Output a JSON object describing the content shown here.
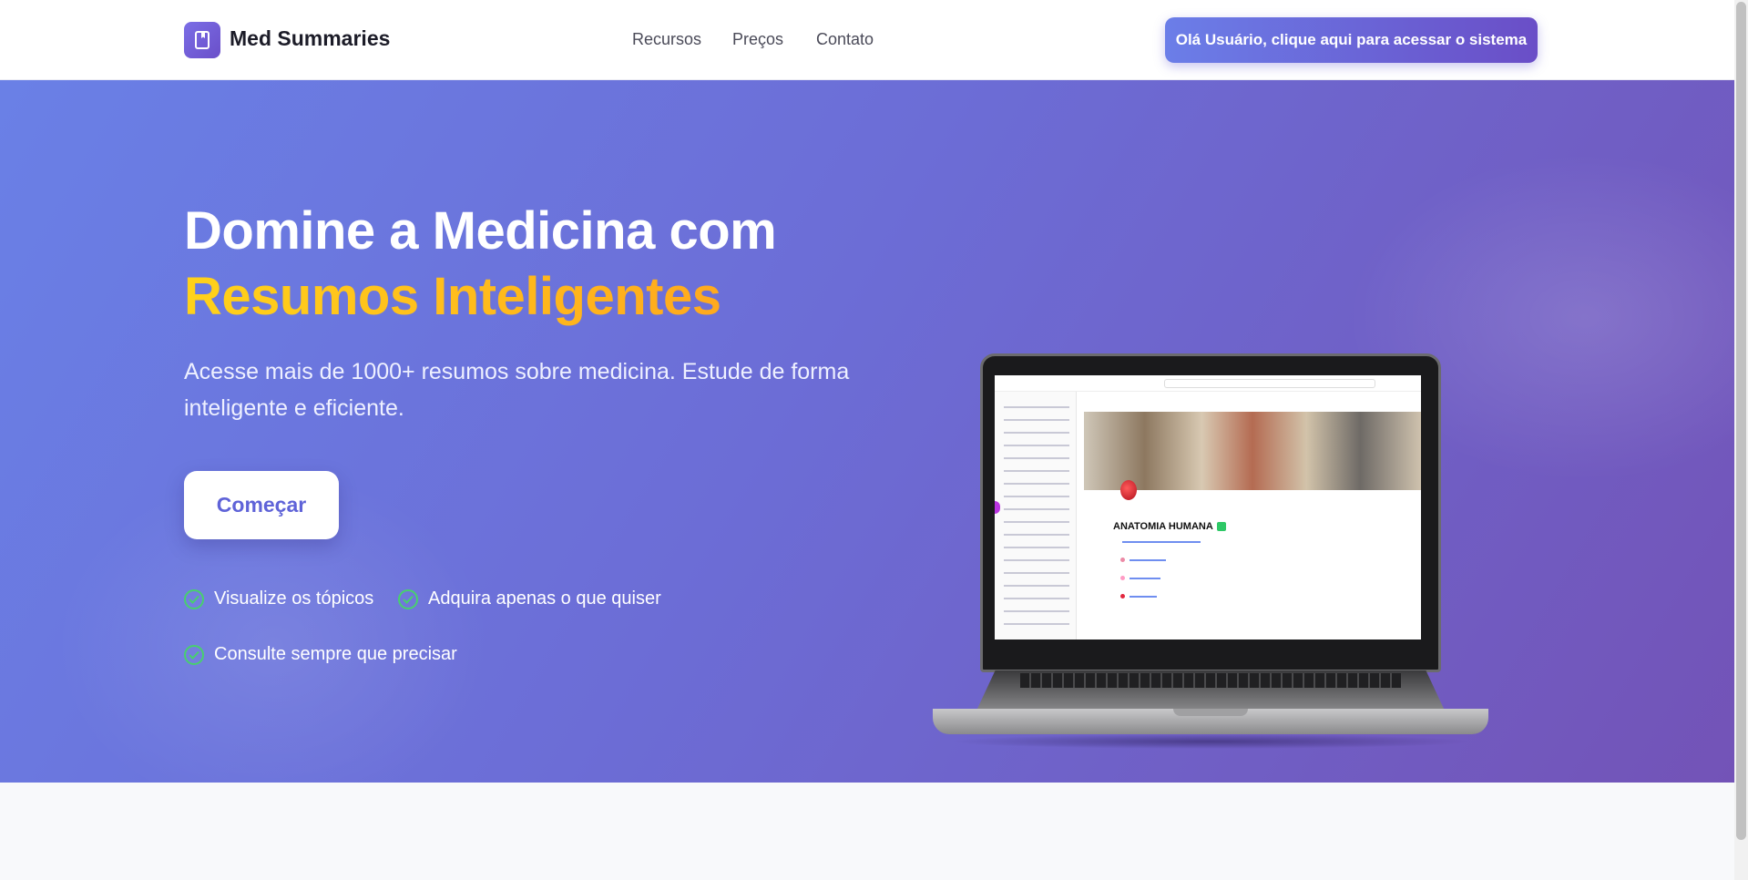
{
  "header": {
    "brand": "Med Summaries",
    "nav": [
      "Recursos",
      "Preços",
      "Contato"
    ],
    "cta_label": "Olá Usuário, clique aqui para acessar o sistema"
  },
  "hero": {
    "headline_line1": "Domine a Medicina com",
    "headline_line2": "Resumos Inteligentes",
    "subtitle": "Acesse mais de 1000+ resumos sobre medicina. Estude de forma inteligente e eficiente.",
    "start_button": "Começar",
    "features": [
      "Visualize os tópicos",
      "Adquira apenas o que quiser",
      "Consulte sempre que precisar"
    ]
  },
  "preview": {
    "title": "ANATOMIA HUMANA"
  },
  "colors": {
    "accent": "#6a4fc9",
    "headline_highlight": "#ffc21a",
    "check": "#48d06e"
  },
  "icons": {
    "logo": "book-icon",
    "feature": "check-circle-icon"
  }
}
